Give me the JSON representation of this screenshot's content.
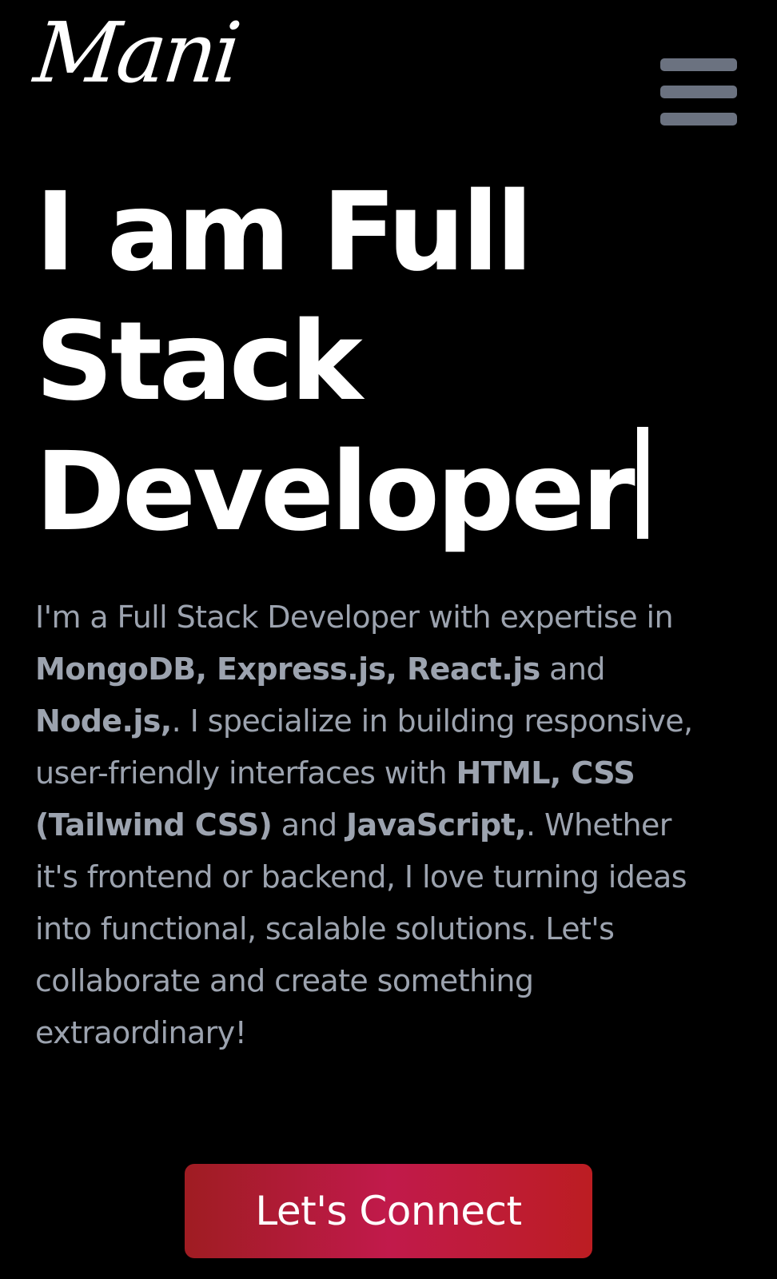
{
  "header": {
    "logo_text": "Mani",
    "menu_icon": "hamburger-menu-icon"
  },
  "hero": {
    "title_line1": "I am Full",
    "title_line2": "Stack",
    "title_line3": "Developer"
  },
  "intro": {
    "t1": "I'm a Full Stack Developer with expertise in ",
    "b1": "MongoDB, Express.js, React.js",
    "t2": " and ",
    "b2": "Node.js,",
    "t3": ". I specialize in building responsive, user-friendly interfaces with ",
    "b3": "HTML, CSS (Tailwind CSS)",
    "t4": " and ",
    "b4": "JavaScript,",
    "t5": ". Whether it's frontend or backend, I love turning ideas into functional, scalable solutions. Let's collaborate and create something extraordinary!"
  },
  "cta": {
    "label": "Let's Connect"
  },
  "colors": {
    "background": "#000000",
    "title": "#ffffff",
    "body_text": "#9ca3af",
    "menu_icon": "#6b7280",
    "button_gradient_start": "#9f1c22",
    "button_gradient_mid": "#c11a4b",
    "button_gradient_end": "#bc1d22"
  }
}
